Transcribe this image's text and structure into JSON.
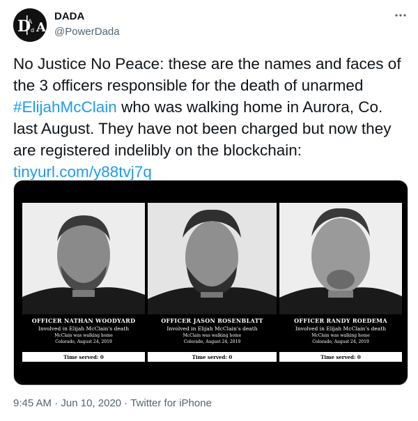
{
  "author": {
    "display_name": "DADA",
    "handle": "@PowerDada",
    "avatar_icon": "dada-logo-icon"
  },
  "more_icon": "more-options-icon",
  "tweet": {
    "text_1": "No Justice No Peace: these are the names and faces of the 3 officers responsible for the death of unarmed ",
    "hashtag": "#ElijahMcClain",
    "text_2": " who was walking home in Aurora, Co. last August. They have not been charged but now they are registered indelibly on the blockchain: ",
    "link": "tinyurl.com/y88tvj7q"
  },
  "media": {
    "panels": [
      {
        "name": "OFFICER NATHAN WOODYARD",
        "involved": "Involved in Elijah McClain's death",
        "line2": "McClain was walking home",
        "line3": "Colorado, August 24, 2019",
        "time_served": "Time served: 0"
      },
      {
        "name": "OFFICER JASON ROSENBLATT",
        "involved": "Involved in Elijah McClain's death",
        "line2": "McClain was walking home",
        "line3": "Colorado, August 24, 2019",
        "time_served": "Time served: 0"
      },
      {
        "name": "OFFICER RANDY ROEDEMA",
        "involved": "Involved in Elijah McClain's death",
        "line2": "McClain was walking home",
        "line3": "Colorado, August 24, 2019",
        "time_served": "Time served: 0"
      }
    ]
  },
  "meta": {
    "time": "9:45 AM",
    "sep1": " · ",
    "date": "Jun 10, 2020",
    "sep2": " · ",
    "source": "Twitter for iPhone"
  },
  "colors": {
    "link": "#1d9bf0",
    "secondary_text": "#536471",
    "primary_text": "#0f1419"
  }
}
